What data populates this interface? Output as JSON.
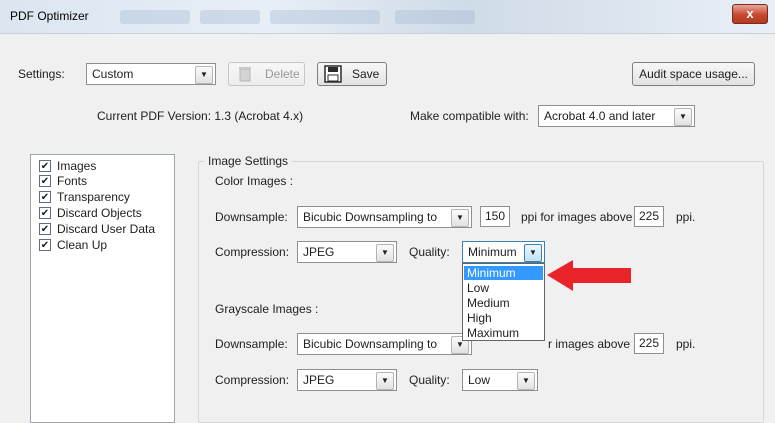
{
  "window": {
    "title": "PDF Optimizer",
    "close_glyph": "x"
  },
  "toolbar": {
    "settings_label": "Settings:",
    "settings_value": "Custom",
    "delete_label": "Delete",
    "save_label": "Save",
    "audit_label": "Audit space usage..."
  },
  "version": {
    "current_label": "Current PDF Version: 1.3 (Acrobat 4.x)",
    "compat_label": "Make compatible with:",
    "compat_value": "Acrobat 4.0 and later"
  },
  "sidebar": {
    "items": [
      {
        "label": "Images",
        "checked": true
      },
      {
        "label": "Fonts",
        "checked": true
      },
      {
        "label": "Transparency",
        "checked": true
      },
      {
        "label": "Discard Objects",
        "checked": true
      },
      {
        "label": "Discard User Data",
        "checked": true
      },
      {
        "label": "Clean Up",
        "checked": true
      }
    ]
  },
  "image_settings": {
    "title": "Image Settings",
    "color": {
      "heading": "Color Images :",
      "downsample_label": "Downsample:",
      "downsample_value": "Bicubic Downsampling to",
      "ppi_value": "150",
      "ppi_label": "ppi for images above",
      "above_value": "225",
      "ppi_suffix": "ppi.",
      "compression_label": "Compression:",
      "compression_value": "JPEG",
      "quality_label": "Quality:",
      "quality_value": "Minimum",
      "quality_options": [
        "Minimum",
        "Low",
        "Medium",
        "High",
        "Maximum"
      ]
    },
    "gray": {
      "heading": "Grayscale Images :",
      "downsample_label": "Downsample:",
      "downsample_value": "Bicubic Downsampling to",
      "ppi_label_partial": "r images above",
      "above_value": "225",
      "ppi_suffix": "ppi.",
      "compression_label": "Compression:",
      "compression_value": "JPEG",
      "quality_label": "Quality:",
      "quality_value": "Low"
    }
  },
  "colors": {
    "accent": "#3399ff",
    "arrow": "#e8232a",
    "close": "#c8482f"
  },
  "icons": {
    "delete": "trash-icon",
    "save": "floppy-disk-icon",
    "dropdown": "chevron-down-icon",
    "annotation": "red-arrow-icon"
  }
}
